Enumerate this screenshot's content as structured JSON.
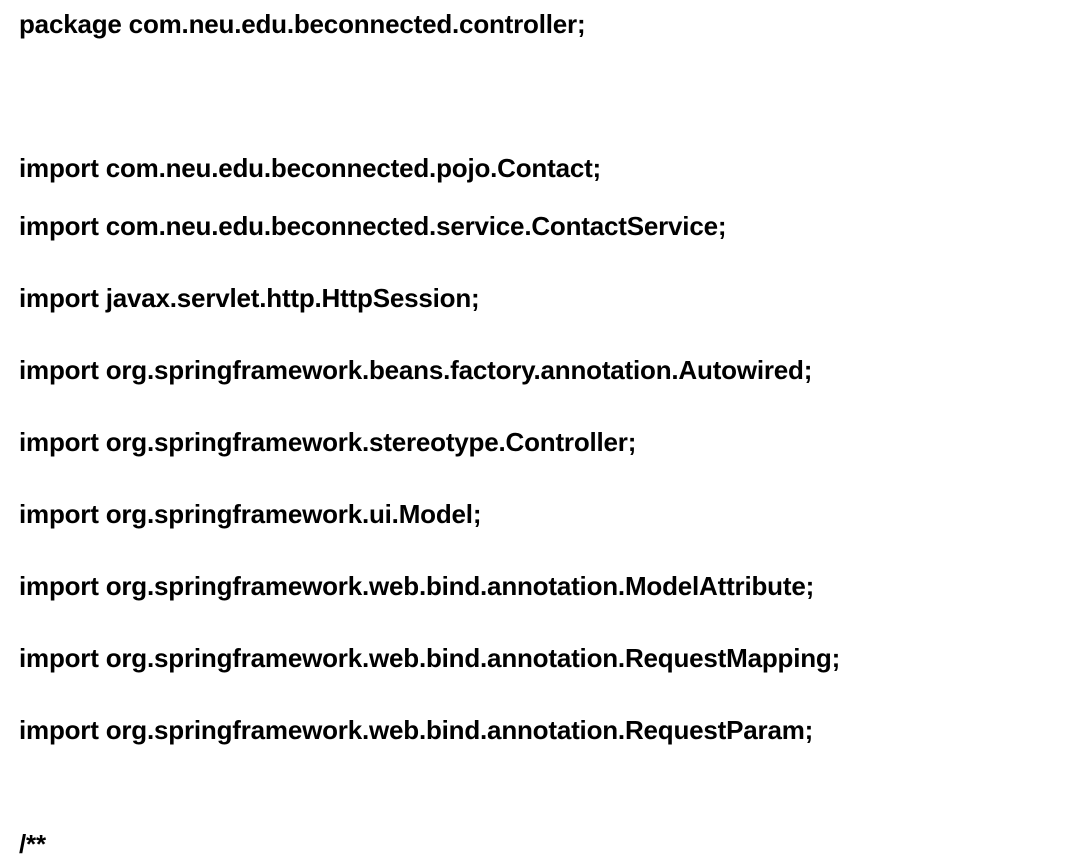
{
  "document": {
    "lines": [
      "package com.neu.edu.beconnected.controller;",
      "import com.neu.edu.beconnected.pojo.Contact;",
      "import com.neu.edu.beconnected.service.ContactService;",
      "import javax.servlet.http.HttpSession;",
      "import org.springframework.beans.factory.annotation.Autowired;",
      "import org.springframework.stereotype.Controller;",
      "import org.springframework.ui.Model;",
      "import org.springframework.web.bind.annotation.ModelAttribute;",
      "import org.springframework.web.bind.annotation.RequestMapping;",
      "import org.springframework.web.bind.annotation.RequestParam;",
      "/**"
    ]
  }
}
